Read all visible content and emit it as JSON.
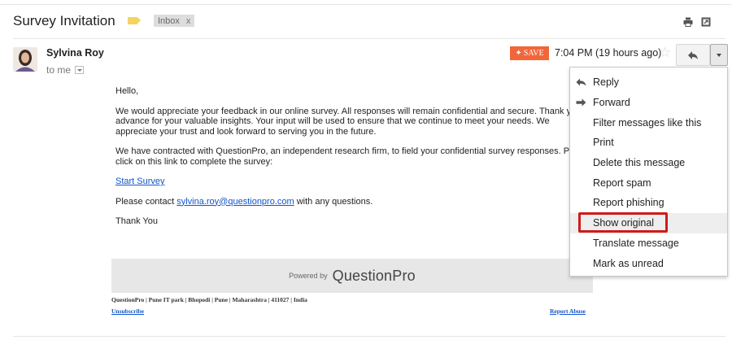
{
  "header": {
    "subject": "Survey Invitation",
    "label_chip": "Inbox",
    "label_chip_close": "x",
    "icons": [
      "print-icon",
      "new-window-icon"
    ]
  },
  "message": {
    "sender": "Sylvina Roy",
    "recipient": "to me",
    "save_label": "SAVE",
    "timestamp": "7:04 PM (19 hours ago)",
    "icons": [
      "star-icon",
      "reply-icon",
      "more-options-icon",
      "tag-icon"
    ]
  },
  "body": {
    "greeting": "Hello,",
    "p1": "We would appreciate your feedback in our online survey. All responses will remain confidential and secure. Thank y\nadvance for your valuable insights. Your input will be used to ensure that we continue to meet your needs. We\nappreciate your trust and look forward to serving you in the future.",
    "p2": "We have contracted with QuestionPro, an independent research firm, to field your confidential survey responses. Pl\nclick on this link to complete the survey:",
    "survey_link": "Start Survey",
    "contact_prefix": "Please contact",
    "contact_email": "sylvina.roy@questionpro.com",
    "contact_suffix": "with any questions.",
    "closing": "Thank You"
  },
  "footer": {
    "powered_by": "Powered by",
    "brand": "QuestionPro",
    "address": "QuestionPro | Pune IT park | Bhopodi | Pune | Maharashtra | 411027 | India",
    "unsubscribe": "Unsubscribe",
    "report_abuse": "Report Abuse"
  },
  "menu": {
    "items": [
      {
        "label": "Reply",
        "icon": "reply-icon"
      },
      {
        "label": "Forward",
        "icon": "forward-icon"
      },
      {
        "label": "Filter messages like this"
      },
      {
        "label": "Print"
      },
      {
        "label": "Delete this message"
      },
      {
        "label": "Report spam"
      },
      {
        "label": "Report phishing"
      },
      {
        "label": "Show original",
        "highlighted": true
      },
      {
        "label": "Translate message"
      },
      {
        "label": "Mark as unread"
      }
    ]
  },
  "colors": {
    "save_button": "#f2663a",
    "link": "#1155cc",
    "highlight_box": "#d11919",
    "label_tag": "#f4d35e"
  }
}
